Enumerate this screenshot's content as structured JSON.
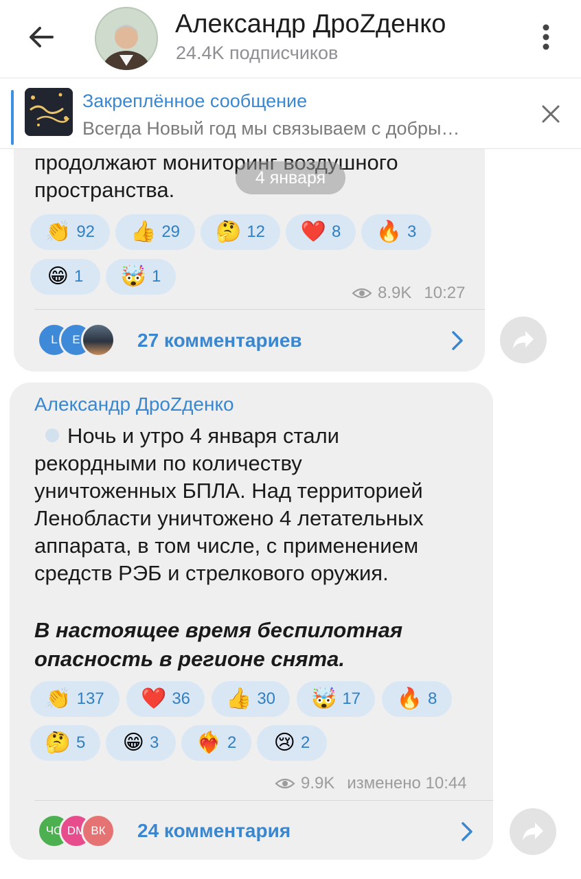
{
  "header": {
    "title": "Александр ДроZденко",
    "subscribers": "24.4K подписчиков"
  },
  "pinned": {
    "title": "Закреплённое сообщение",
    "text": "Всегда Новый год мы связываем с добры…"
  },
  "date_separator": "4 января",
  "post1": {
    "text_tail": "продолжают мониторинг воздушного\nпространства.",
    "reactions": [
      {
        "emoji": "👏",
        "count": "92"
      },
      {
        "emoji": "👍",
        "count": "29"
      },
      {
        "emoji": "🤔",
        "count": "12"
      },
      {
        "emoji": "❤️",
        "count": "8"
      },
      {
        "emoji": "🔥",
        "count": "3"
      },
      {
        "emoji": "😁",
        "count": "1"
      },
      {
        "emoji": "🤯",
        "count": "1"
      }
    ],
    "views": "8.9K",
    "time": "10:27",
    "comments": "27 комментариев",
    "comment_avatars": [
      {
        "initial": "L",
        "color": "#3f8ad8"
      },
      {
        "initial": "E",
        "color": "#3f8ad8"
      },
      {
        "initial": "",
        "color": "#4a5a6a"
      }
    ]
  },
  "post2": {
    "author": "Александр ДроZденко",
    "text": "Ночь и утро 4 января стали\nрекордными по количеству\nуничтоженных БПЛА. Над территорией\nЛенобласти уничтожено 4 летательных\nаппарата, в том числе, с применением\nсредств РЭБ и стрелкового оружия.",
    "text_italic": "В настоящее время беспилотная\nопасность в регионе снята.",
    "reactions": [
      {
        "emoji": "👏",
        "count": "137"
      },
      {
        "emoji": "❤️",
        "count": "36"
      },
      {
        "emoji": "👍",
        "count": "30"
      },
      {
        "emoji": "🤯",
        "count": "17"
      },
      {
        "emoji": "🔥",
        "count": "8"
      },
      {
        "emoji": "🤔",
        "count": "5"
      },
      {
        "emoji": "😁",
        "count": "3"
      },
      {
        "emoji": "❤️‍🔥",
        "count": "2"
      },
      {
        "emoji": "😢",
        "count": "2"
      }
    ],
    "views": "9.9K",
    "time": "изменено 10:44",
    "comments": "24 комментария",
    "comment_avatars": [
      {
        "initial": "ЧО",
        "color": "#4caf50"
      },
      {
        "initial": "DM",
        "color": "#e74c8c"
      },
      {
        "initial": "ВК",
        "color": "#e57373"
      }
    ]
  }
}
